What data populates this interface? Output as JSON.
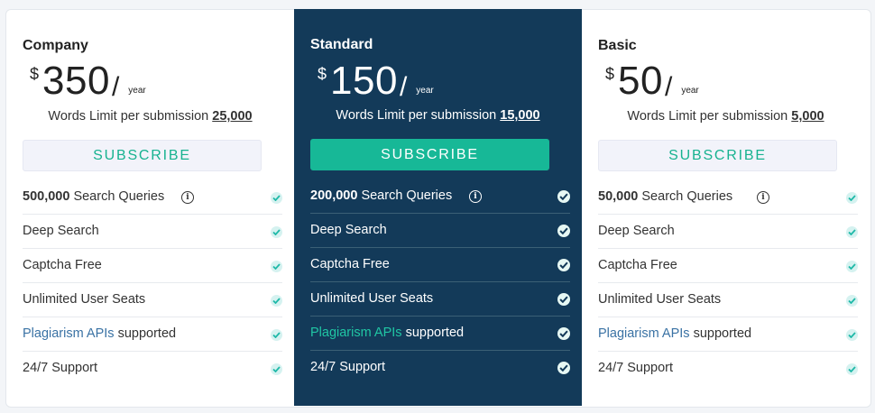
{
  "plans": [
    {
      "name": "Company",
      "currency": "$",
      "amount": "350",
      "slash": "/",
      "period": "year",
      "limit_label": "Words Limit per submission",
      "limit_value": "25,000",
      "button": "SUBSCRIBE",
      "queries_count": "500,000",
      "queries_label": " Search Queries",
      "info_icon": "info-icon",
      "features": [
        "Deep Search",
        "Captcha Free",
        "Unlimited User Seats"
      ],
      "api_link": "Plagiarism APIs",
      "api_suffix": " supported",
      "support": "24/7 Support"
    },
    {
      "name": "Standard",
      "currency": "$",
      "amount": "150",
      "slash": "/",
      "period": "year",
      "limit_label": "Words Limit per submission",
      "limit_value": "15,000",
      "button": "SUBSCRIBE",
      "queries_count": "200,000",
      "queries_label": " Search Queries",
      "info_icon": "info-icon",
      "features": [
        "Deep Search",
        "Captcha Free",
        "Unlimited User Seats"
      ],
      "api_link": "Plagiarism APIs",
      "api_suffix": " supported",
      "support": "24/7 Support"
    },
    {
      "name": "Basic",
      "currency": "$",
      "amount": "50",
      "slash": "/",
      "period": "year",
      "limit_label": "Words Limit per submission",
      "limit_value": "5,000",
      "button": "SUBSCRIBE",
      "queries_count": "50,000",
      "queries_label": " Search Queries",
      "info_icon": "info-icon",
      "features": [
        "Deep Search",
        "Captcha Free",
        "Unlimited User Seats"
      ],
      "api_link": "Plagiarism APIs",
      "api_suffix": " supported",
      "support": "24/7 Support"
    }
  ],
  "colors": {
    "highlight_bg": "#133a59",
    "accent": "#17b897",
    "link": "#3a72a4",
    "check_icon": "check-icon"
  }
}
